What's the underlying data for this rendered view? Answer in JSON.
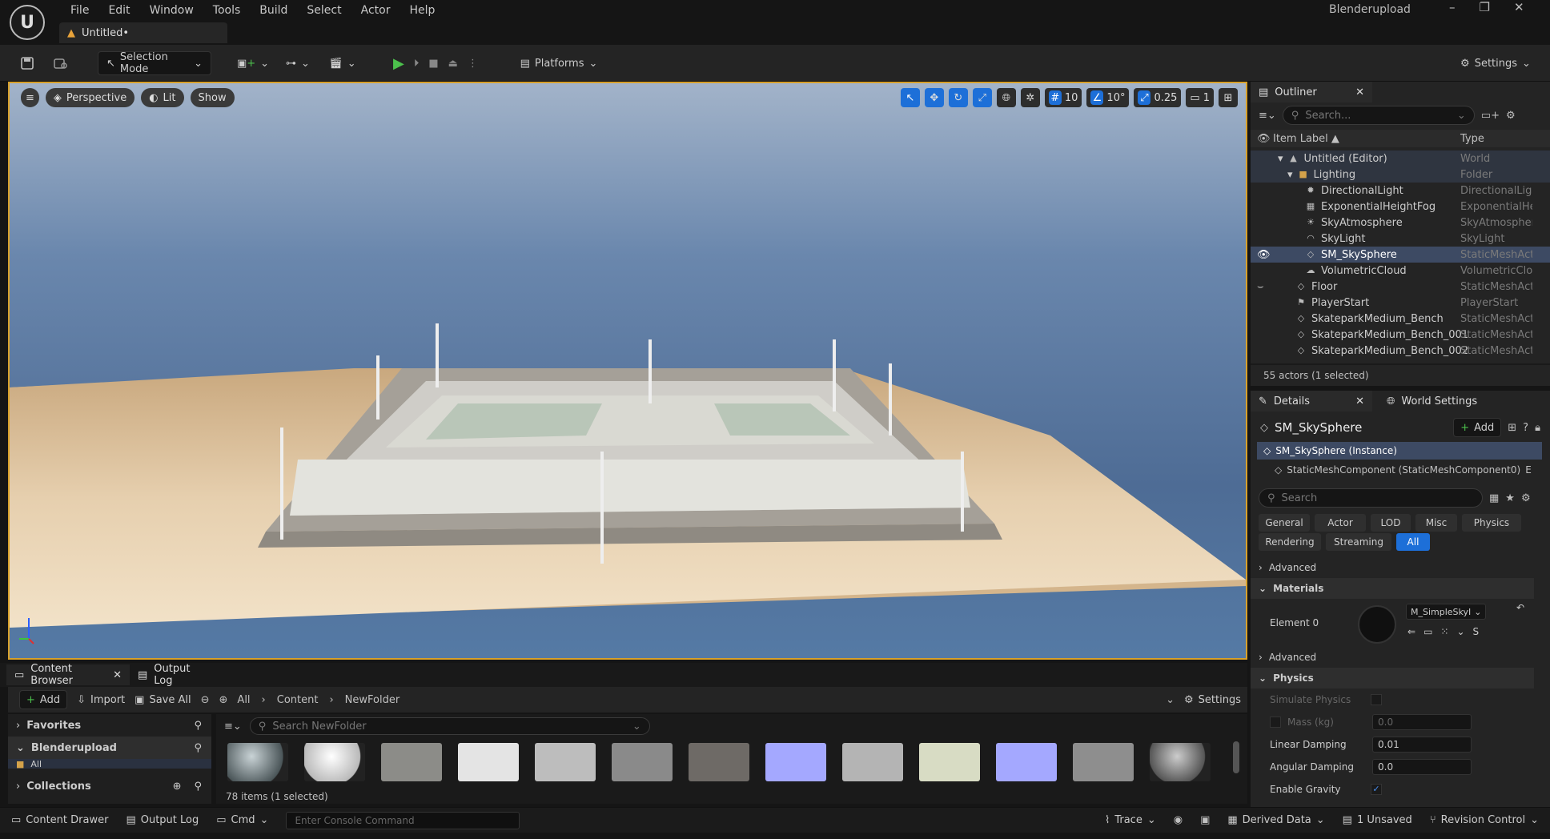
{
  "titlebar": {
    "logo": "U",
    "menu": [
      "File",
      "Edit",
      "Window",
      "Tools",
      "Build",
      "Select",
      "Actor",
      "Help"
    ],
    "doc_tab": "Untitled•",
    "project": "Blenderupload",
    "window_controls": [
      "–",
      "❐",
      "✕"
    ]
  },
  "toolbar": {
    "selection_mode": "Selection Mode",
    "platforms": "Platforms",
    "settings": "Settings"
  },
  "viewport": {
    "perspective": "Perspective",
    "lit": "Lit",
    "show": "Show",
    "grid_snap": "10",
    "rotation_snap": "10°",
    "scale_snap": "0.25",
    "camera_speed": "1"
  },
  "outliner": {
    "tab": "Outliner",
    "search_placeholder": "Search...",
    "col_label": "Item Label ▲",
    "col_type": "Type",
    "rows": [
      {
        "label": "Untitled (Editor)",
        "type": "World"
      },
      {
        "label": "Lighting",
        "type": "Folder"
      },
      {
        "label": "DirectionalLight",
        "type": "DirectionalLigh"
      },
      {
        "label": "ExponentialHeightFog",
        "type": "ExponentialHei"
      },
      {
        "label": "SkyAtmosphere",
        "type": "SkyAtmospher"
      },
      {
        "label": "SkyLight",
        "type": "SkyLight"
      },
      {
        "label": "SM_SkySphere",
        "type": "StaticMeshAct"
      },
      {
        "label": "VolumetricCloud",
        "type": "VolumetricClou"
      },
      {
        "label": "Floor",
        "type": "StaticMeshAct"
      },
      {
        "label": "PlayerStart",
        "type": "PlayerStart"
      },
      {
        "label": "SkateparkMedium_Bench",
        "type": "StaticMeshAct"
      },
      {
        "label": "SkateparkMedium_Bench_001",
        "type": "StaticMeshAct"
      },
      {
        "label": "SkateparkMedium_Bench_002",
        "type": "StaticMeshAct"
      }
    ],
    "footer": "55 actors (1 selected)"
  },
  "details": {
    "tab": "Details",
    "world_settings_tab": "World Settings",
    "actor_name": "SM_SkySphere",
    "add": "Add",
    "instance": "SM_SkySphere (Instance)",
    "component": "StaticMeshComponent (StaticMeshComponent0)",
    "component_trail": "E",
    "search_placeholder": "Search",
    "filters_row1": [
      "General",
      "Actor",
      "LOD",
      "Misc",
      "Physics"
    ],
    "filters_row2": [
      "Rendering",
      "Streaming",
      "All"
    ],
    "advanced": "Advanced",
    "materials": "Materials",
    "element0": "Element 0",
    "material_name": "M_SimpleSkyI",
    "material_s": "S",
    "advanced2": "Advanced",
    "physics": "Physics",
    "simulate_physics": "Simulate Physics",
    "mass_label": "Mass (kg)",
    "mass_value": "0.0",
    "linear_damping_label": "Linear Damping",
    "linear_damping": "0.01",
    "angular_damping_label": "Angular Damping",
    "angular_damping": "0.0",
    "enable_gravity": "Enable Gravity"
  },
  "content_browser": {
    "tab": "Content Browser",
    "output_tab": "Output Log",
    "add": "Add",
    "import": "Import",
    "save_all": "Save All",
    "path": [
      "All",
      "Content",
      "NewFolder"
    ],
    "settings": "Settings",
    "favorites": "Favorites",
    "project": "Blenderupload",
    "all": "All",
    "collections": "Collections",
    "search_placeholder": "Search NewFolder",
    "count": "78 items (1 selected)"
  },
  "statusbar": {
    "content_drawer": "Content Drawer",
    "output_log": "Output Log",
    "cmd": "Cmd",
    "console_placeholder": "Enter Console Command",
    "trace": "Trace",
    "derived_data": "Derived Data",
    "unsaved": "1 Unsaved",
    "revision_control": "Revision Control"
  },
  "colors": {
    "accent": "#1d6fd8",
    "viewport_border": "#d8a12b",
    "panel": "#242424"
  }
}
